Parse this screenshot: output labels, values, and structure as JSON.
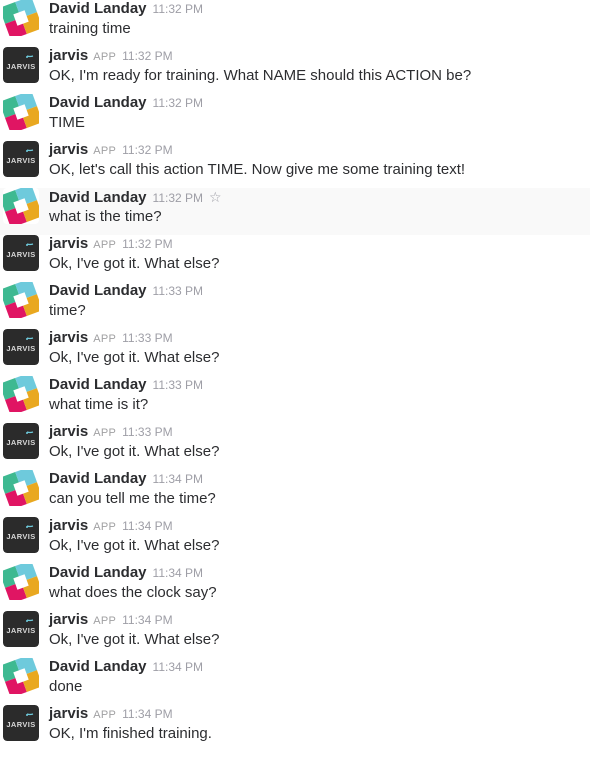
{
  "messages": [
    {
      "author": "David Landay",
      "kind": "user",
      "time": "11:32 PM",
      "text": "training time"
    },
    {
      "author": "jarvis",
      "kind": "app",
      "badge": "APP",
      "time": "11:32 PM",
      "text": "OK, I'm ready for training. What NAME should this ACTION be?"
    },
    {
      "author": "David Landay",
      "kind": "user",
      "time": "11:32 PM",
      "text": "TIME"
    },
    {
      "author": "jarvis",
      "kind": "app",
      "badge": "APP",
      "time": "11:32 PM",
      "text": "OK, let's call this action TIME. Now give me some training text!"
    },
    {
      "author": "David Landay",
      "kind": "user",
      "time": "11:32 PM",
      "text": "what is the time?",
      "highlight": true,
      "star_icon": "star-outline-icon"
    },
    {
      "author": "jarvis",
      "kind": "app",
      "badge": "APP",
      "time": "11:32 PM",
      "text": "Ok, I've got it. What else?"
    },
    {
      "author": "David Landay",
      "kind": "user",
      "time": "11:33 PM",
      "text": "time?"
    },
    {
      "author": "jarvis",
      "kind": "app",
      "badge": "APP",
      "time": "11:33 PM",
      "text": "Ok, I've got it. What else?"
    },
    {
      "author": "David Landay",
      "kind": "user",
      "time": "11:33 PM",
      "text": "what time is it?"
    },
    {
      "author": "jarvis",
      "kind": "app",
      "badge": "APP",
      "time": "11:33 PM",
      "text": "Ok, I've got it. What else?"
    },
    {
      "author": "David Landay",
      "kind": "user",
      "time": "11:34 PM",
      "text": "can you tell me the time?"
    },
    {
      "author": "jarvis",
      "kind": "app",
      "badge": "APP",
      "time": "11:34 PM",
      "text": "Ok, I've got it. What else?"
    },
    {
      "author": "David Landay",
      "kind": "user",
      "time": "11:34 PM",
      "text": "what does the clock say?"
    },
    {
      "author": "jarvis",
      "kind": "app",
      "badge": "APP",
      "time": "11:34 PM",
      "text": "Ok, I've got it. What else?"
    },
    {
      "author": "David Landay",
      "kind": "user",
      "time": "11:34 PM",
      "text": "done"
    },
    {
      "author": "jarvis",
      "kind": "app",
      "badge": "APP",
      "time": "11:34 PM",
      "text": "OK, I'm finished training."
    }
  ],
  "avatars": {
    "user": {
      "icon": "slack-logo-avatar-icon",
      "colors": [
        "#e01563",
        "#3eb991",
        "#e9a820",
        "#6ecadc"
      ]
    },
    "app": {
      "icon": "jarvis-logo-avatar-icon",
      "logo_text": "JARVIS",
      "colors": [
        "#2b2b2b",
        "#6ecadc"
      ]
    }
  }
}
